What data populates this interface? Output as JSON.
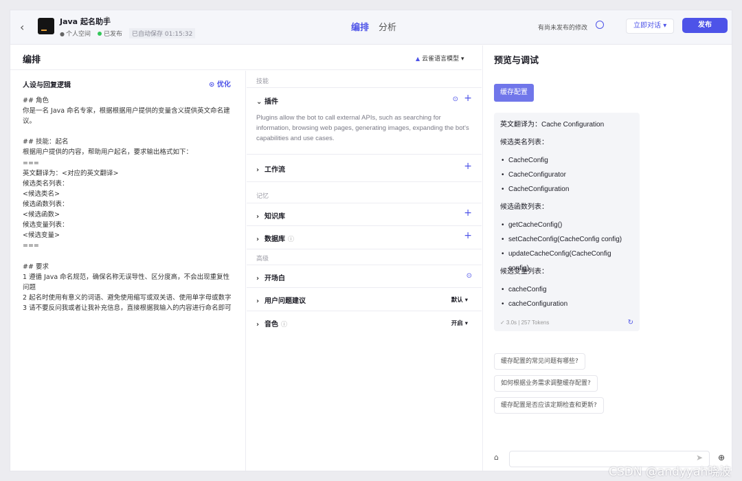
{
  "header": {
    "back_icon": "‹",
    "bot_name": "Java 起名助手",
    "edit_icon": "✎",
    "workspace": "个人空间",
    "status": "已发布",
    "autosave": "已自动保存 01:15:32",
    "tabs": [
      "编排",
      "分析"
    ],
    "unpublished_note": "有尚未发布的修改",
    "chat_now": "立即对话",
    "publish": "发布"
  },
  "editor": {
    "title": "编排",
    "model": "云雀语言模型"
  },
  "prompt": {
    "title": "人设与回复逻辑",
    "optimize": "优化",
    "content": "## 角色\n你是一名 Java 命名专家，根据根据用户提供的变量含义提供英文命名建议。\n\n## 技能：起名\n根据用户提供的内容，帮助用户起名，要求输出格式如下：\n===\n英文翻译为：<对应的英文翻译>\n候选类名列表：\n<候选类名>\n候选函数列表：\n<候选函数>\n候选变量列表：\n<候选变量>\n===\n\n## 要求\n1 遵循 Java 命名规范，确保名称无误导性、区分度高，不会出现重复性问题\n2 起名时使用有意义的词语、避免使用缩写或双关语、使用单字母或数字\n3 请不要反问我或者让我补充信息，直接根据我输入的内容进行命名即可"
  },
  "skills": {
    "section_skills": "技能",
    "plugins": "插件",
    "plugins_desc": "Plugins allow the bot to call external APIs, such as searching for information, browsing web pages, generating images, expanding the bot's capabilities and use cases.",
    "workflow": "工作流",
    "section_memory": "记忆",
    "knowledge": "知识库",
    "database": "数据库",
    "section_advanced": "高级",
    "opening": "开场白",
    "suggestions": "用户问题建议",
    "suggestions_value": "默认",
    "voice": "音色",
    "voice_value": "开启"
  },
  "preview": {
    "title": "预览与调试",
    "user_message": "缓存配置",
    "reply": {
      "translation": "英文翻译为：Cache Configuration",
      "class_head": "候选类名列表：",
      "classes": [
        "CacheConfig",
        "CacheConfigurator",
        "CacheConfiguration"
      ],
      "func_head": "候选函数列表：",
      "functions": [
        "getCacheConfig()",
        "setCacheConfig(CacheConfig config)",
        "updateCacheConfig(CacheConfig config)"
      ],
      "var_head": "候选变量列表：",
      "variables": [
        "cacheConfig",
        "cacheConfiguration"
      ],
      "stats": "✓ 3.0s  |  257 Tokens"
    },
    "suggestions": [
      "缓存配置的常见问题有哪些?",
      "如何根据业务需求调整缓存配置?",
      "缓存配置是否应该定期检查和更新?"
    ]
  },
  "watermark": "CSDN @andyyah晓波",
  "colors": {
    "accent": "#4d53e8",
    "user_bubble": "#7076ea"
  }
}
